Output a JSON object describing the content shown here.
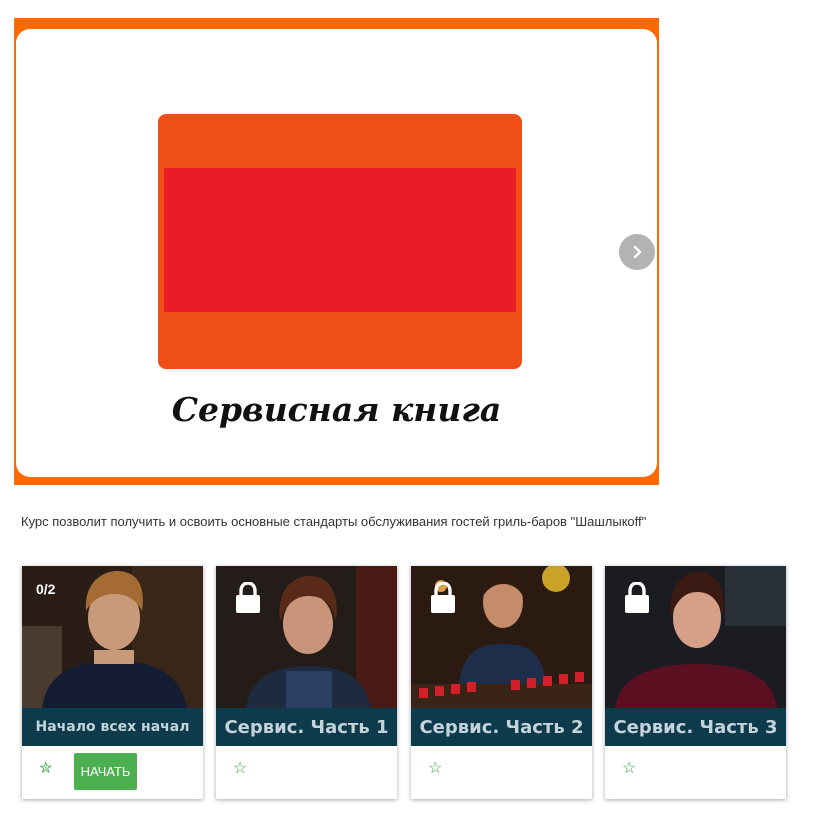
{
  "banner": {
    "title": "Сервисная книга"
  },
  "navigation": {
    "next_icon": "chevron-right-icon"
  },
  "course": {
    "description": "Курс позволит получить и освоить основные стандарты обслуживания гостей гриль-баров \"Шашлыкoff\""
  },
  "lessons": [
    {
      "caption": "Начало всех начал",
      "progress": "0/2",
      "locked": false,
      "start_label": "НАЧАТЬ"
    },
    {
      "caption": "Сервис. Часть 1",
      "locked": true
    },
    {
      "caption": "Сервис. Часть 2",
      "locked": true
    },
    {
      "caption": "Сервис. Часть 3",
      "locked": true
    }
  ],
  "colors": {
    "banner_frame": "#ff6a00",
    "logo_orange": "#f04e17",
    "logo_red": "#ec1c27",
    "caption_bar": "#0d3b4c",
    "start_button": "#4caf50",
    "star": "#3aa84a"
  }
}
